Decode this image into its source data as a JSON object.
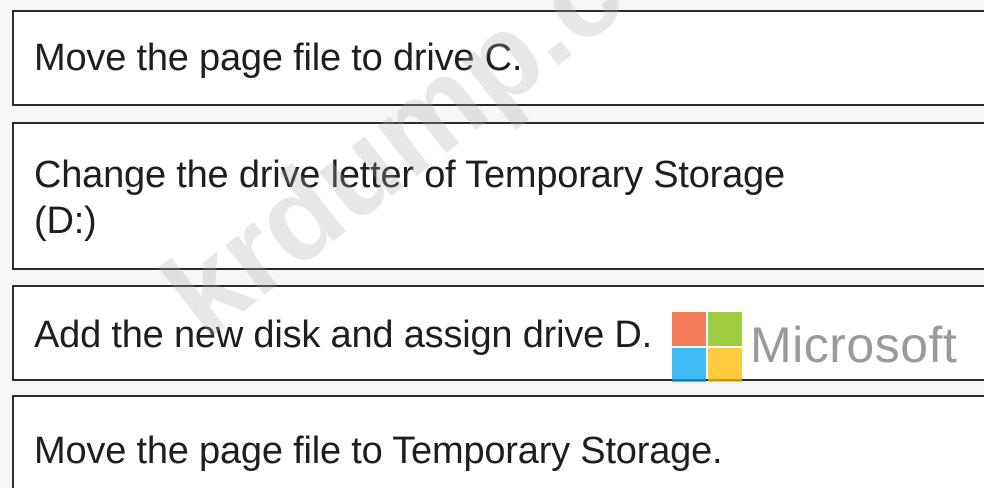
{
  "items": [
    {
      "text": "Move the page file to drive C."
    },
    {
      "text": "Change the drive letter of Temporary Storage\n(D:)"
    },
    {
      "text": "Add the new disk and assign drive D."
    },
    {
      "text": "Move the page file to Temporary Storage."
    }
  ],
  "watermark": {
    "text": "krdump.com"
  },
  "logo": {
    "wordmark": "Microsoft",
    "colors": {
      "red": "#f25022",
      "green": "#7fba00",
      "blue": "#00a4ef",
      "yellow": "#ffb900"
    }
  }
}
